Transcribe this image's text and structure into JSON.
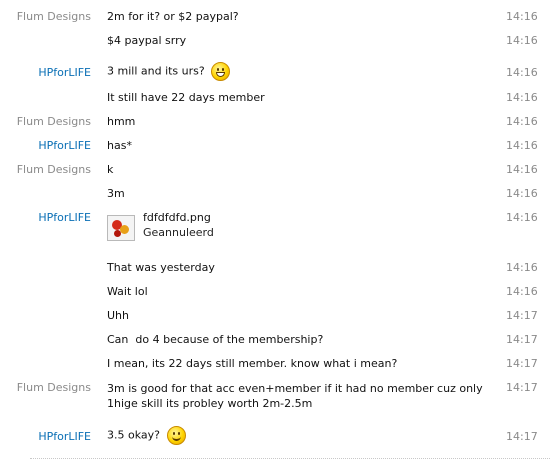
{
  "senders": {
    "flum": "Flum Designs",
    "hp": "HPforLIFE"
  },
  "colors": {
    "flum_sender": "#8a8a8a",
    "hp_sender": "#0a6fb5",
    "timestamp": "#8a8a8a"
  },
  "messages": [
    {
      "sender": "Flum Designs",
      "text": "2m for it? or $2 paypal?",
      "time": "14:16"
    },
    {
      "sender": "",
      "text": "$4 paypal srry",
      "time": "14:16"
    },
    {
      "sender": "HPforLIFE",
      "text": "3 mill and its urs?",
      "emoticon": "grin-smiley-icon",
      "time": "14:16"
    },
    {
      "sender": "",
      "text": "It still have 22 days member",
      "time": "14:16"
    },
    {
      "sender": "Flum Designs",
      "text": "hmm",
      "time": "14:16"
    },
    {
      "sender": "HPforLIFE",
      "text": "has*",
      "time": "14:16"
    },
    {
      "sender": "Flum Designs",
      "text": "k",
      "time": "14:16"
    },
    {
      "sender": "",
      "text": "3m",
      "time": "14:16"
    },
    {
      "sender": "HPforLIFE",
      "file": {
        "name": "fdfdfdfd.png",
        "status": "Geannuleerd",
        "icon": "image-file-icon"
      },
      "time": "14:16"
    },
    {
      "sender": "",
      "text": "That was yesterday",
      "time": "14:16"
    },
    {
      "sender": "",
      "text": "Wait lol",
      "time": "14:16"
    },
    {
      "sender": "",
      "text": "Uhh",
      "time": "14:17"
    },
    {
      "sender": "",
      "text": "Can  do 4 because of the membership?",
      "time": "14:17"
    },
    {
      "sender": "",
      "text": "I mean, its 22 days still member. know what i mean?",
      "time": "14:17"
    },
    {
      "sender": "Flum Designs",
      "text": "3m is good for that acc even+member if it had no member cuz only 1hige skill its probley worth 2m-2.5m",
      "time": "14:17"
    },
    {
      "sender": "HPforLIFE",
      "text": "3.5 okay?",
      "emoticon": "smile-smiley-icon",
      "time": "14:17"
    }
  ]
}
